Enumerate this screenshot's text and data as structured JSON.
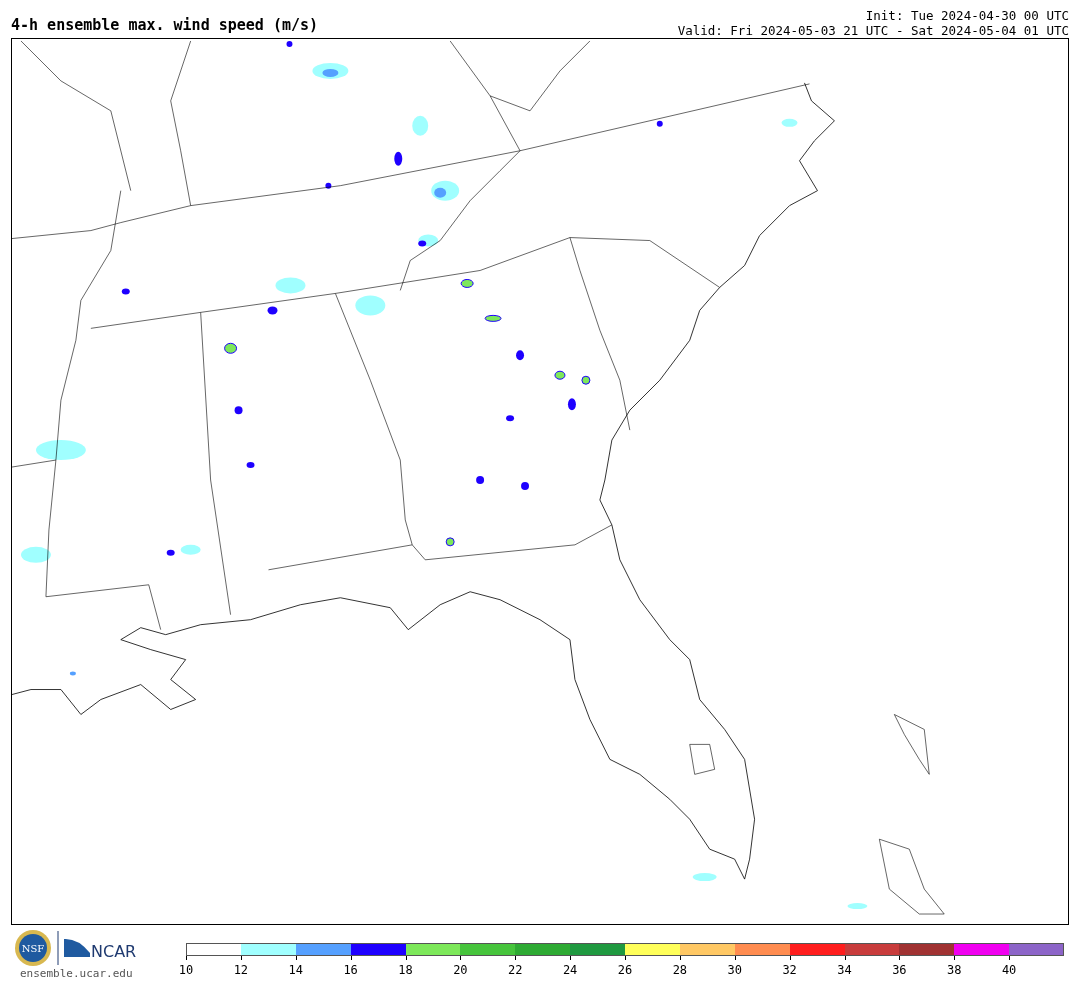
{
  "title": "4-h ensemble max. wind speed (m/s)",
  "init": "Init: Tue 2024-04-30 00 UTC",
  "valid": "Valid: Fri 2024-05-03 21 UTC - Sat 2024-05-04 01 UTC",
  "footer": {
    "nsf_text": "NSF",
    "ncar_text": "NCAR",
    "site": "ensemble.ucar.edu"
  },
  "colorbar": {
    "segments": [
      {
        "color": "#ffffff"
      },
      {
        "color": "#a0ffff"
      },
      {
        "color": "#55a0ff"
      },
      {
        "color": "#1e00ff"
      },
      {
        "color": "#7de85a"
      },
      {
        "color": "#46c43c"
      },
      {
        "color": "#2eaa33"
      },
      {
        "color": "#1f9940"
      },
      {
        "color": "#ffff5a"
      },
      {
        "color": "#ffc864"
      },
      {
        "color": "#ff8c50"
      },
      {
        "color": "#ff1e1e"
      },
      {
        "color": "#c83c3c"
      },
      {
        "color": "#a03232"
      },
      {
        "color": "#f000f0"
      },
      {
        "color": "#8c64c8"
      }
    ],
    "ticks": [
      "10",
      "12",
      "14",
      "16",
      "18",
      "20",
      "22",
      "24",
      "26",
      "28",
      "30",
      "32",
      "34",
      "36",
      "38",
      "40"
    ]
  }
}
